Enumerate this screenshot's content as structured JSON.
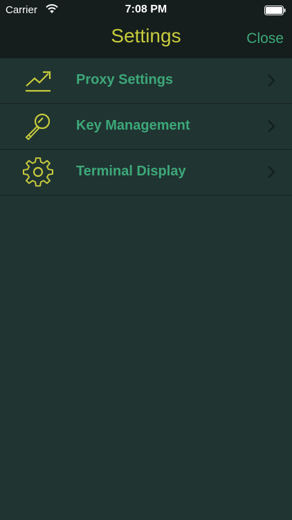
{
  "status_bar": {
    "carrier": "Carrier",
    "time": "7:08 PM"
  },
  "nav": {
    "title": "Settings",
    "close_label": "Close"
  },
  "menu": {
    "items": [
      {
        "label": "Proxy Settings",
        "icon": "trend-up-chart-icon"
      },
      {
        "label": "Key Management",
        "icon": "key-icon"
      },
      {
        "label": "Terminal Display",
        "icon": "gear-icon"
      }
    ]
  },
  "colors": {
    "background": "#203432",
    "nav_background": "#151e1c",
    "title": "#c8cc3c",
    "accent_green": "#3da879",
    "icon_yellow": "#c8cc3c",
    "chevron": "#13201d"
  }
}
